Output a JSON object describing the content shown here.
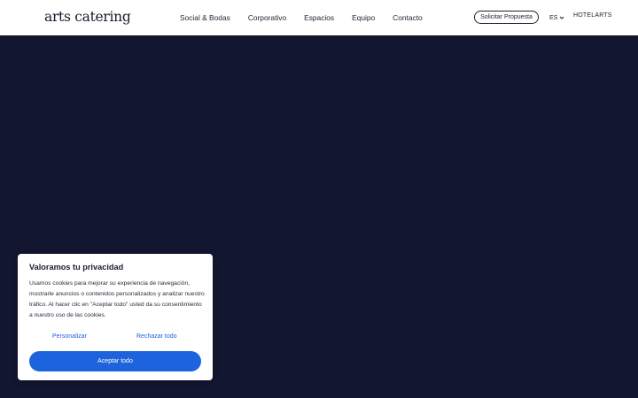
{
  "header": {
    "logo": "arts catering",
    "nav": [
      "Social & Bodas",
      "Corporativo",
      "Espacios",
      "Equipo",
      "Contacto"
    ],
    "cta_label": "Solicitar Propuesta",
    "language": "ES",
    "brand_link": "HOTELARTS"
  },
  "cookie_banner": {
    "title": "Valoramos tu privacidad",
    "body": "Usamos cookies para mejorar su experiencia de navegación, mostrarle anuncios o contenidos personalizados y analizar nuestro tráfico. Al hacer clic en \"Aceptar todo\" usted da su consentimiento a nuestro uso de las cookies.",
    "customize_label": "Personalizar",
    "reject_label": "Rechazar todo",
    "accept_label": "Aceptar todo"
  },
  "colors": {
    "hero_background": "#131631",
    "accent": "#1d63dd",
    "link": "#1f5fd6"
  },
  "icons": {
    "language_chevron": "chevron-down-icon"
  }
}
